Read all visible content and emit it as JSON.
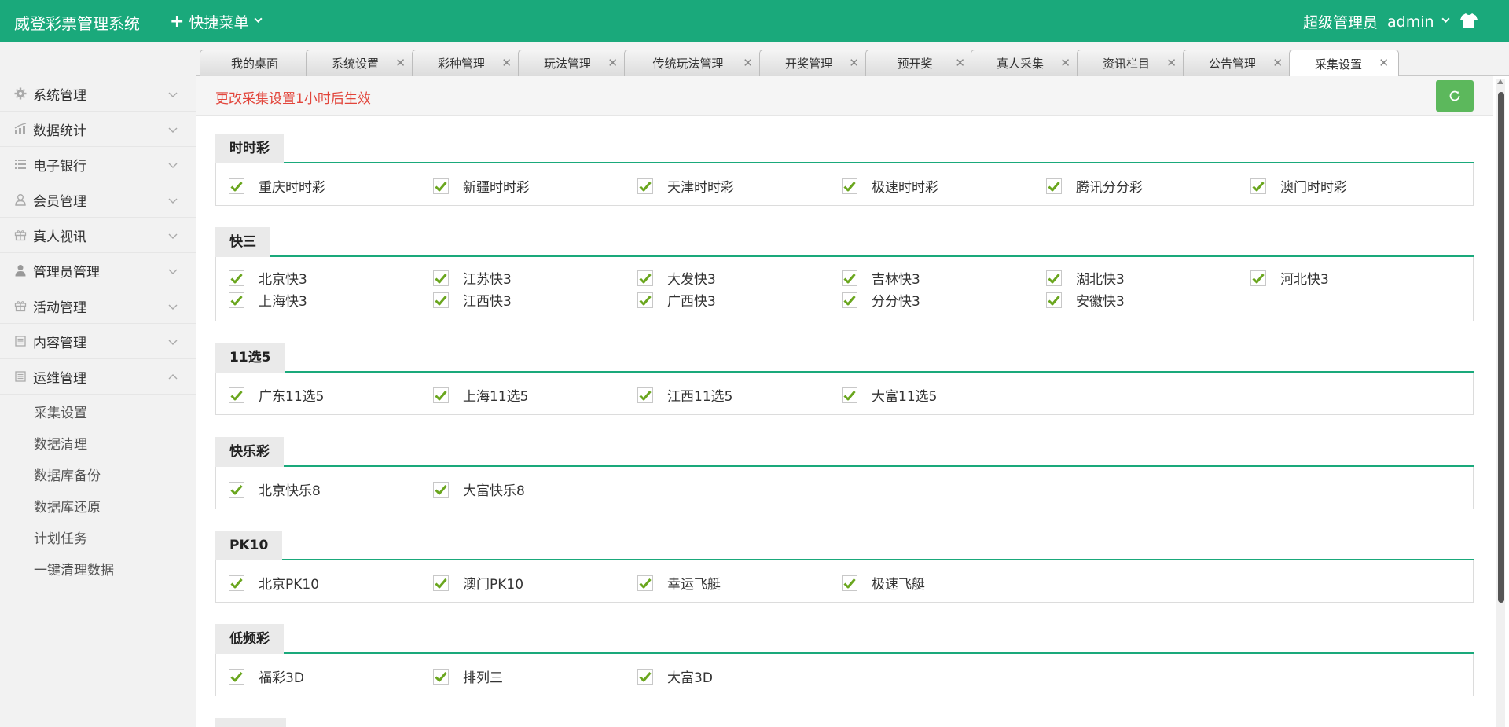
{
  "header": {
    "app_title": "威登彩票管理系统",
    "quick_menu_label": "快捷菜单",
    "user_role": "超级管理员",
    "username": "admin"
  },
  "colors": {
    "brand": "#1aa97b",
    "notice": "#e2453b",
    "refresh_button": "#5cb85c",
    "check": "#6aa61e"
  },
  "sidebar": {
    "items": [
      {
        "label": "系统管理",
        "icon": "gear-icon"
      },
      {
        "label": "数据统计",
        "icon": "chart-icon"
      },
      {
        "label": "电子银行",
        "icon": "list-icon"
      },
      {
        "label": "会员管理",
        "icon": "user-icon"
      },
      {
        "label": "真人视讯",
        "icon": "gift-icon"
      },
      {
        "label": "管理员管理",
        "icon": "admin-icon"
      },
      {
        "label": "活动管理",
        "icon": "gift-icon"
      },
      {
        "label": "内容管理",
        "icon": "document-icon"
      },
      {
        "label": "运维管理",
        "icon": "document-icon"
      }
    ],
    "submenu": [
      "采集设置",
      "数据清理",
      "数据库备份",
      "数据库还原",
      "计划任务",
      "一键清理数据"
    ]
  },
  "tabs": [
    "我的桌面",
    "系统设置",
    "彩种管理",
    "玩法管理",
    "传统玩法管理",
    "开奖管理",
    "预开奖",
    "真人采集",
    "资讯栏目",
    "公告管理",
    "采集设置"
  ],
  "notice": "更改采集设置1小时后生效",
  "sections": [
    {
      "title": "时时彩",
      "items": [
        "重庆时时彩",
        "新疆时时彩",
        "天津时时彩",
        "极速时时彩",
        "腾讯分分彩",
        "澳门时时彩"
      ]
    },
    {
      "title": "快三",
      "items": [
        "北京快3",
        "江苏快3",
        "大发快3",
        "吉林快3",
        "湖北快3",
        "河北快3",
        "上海快3",
        "江西快3",
        "广西快3",
        "分分快3",
        "安徽快3"
      ]
    },
    {
      "title": "11选5",
      "items": [
        "广东11选5",
        "上海11选5",
        "江西11选5",
        "大富11选5"
      ]
    },
    {
      "title": "快乐彩",
      "items": [
        "北京快乐8",
        "大富快乐8"
      ]
    },
    {
      "title": "PK10",
      "items": [
        "北京PK10",
        "澳门PK10",
        "幸运飞艇",
        "极速飞艇"
      ]
    },
    {
      "title": "低频彩",
      "items": [
        "福彩3D",
        "排列三",
        "大富3D"
      ]
    }
  ]
}
